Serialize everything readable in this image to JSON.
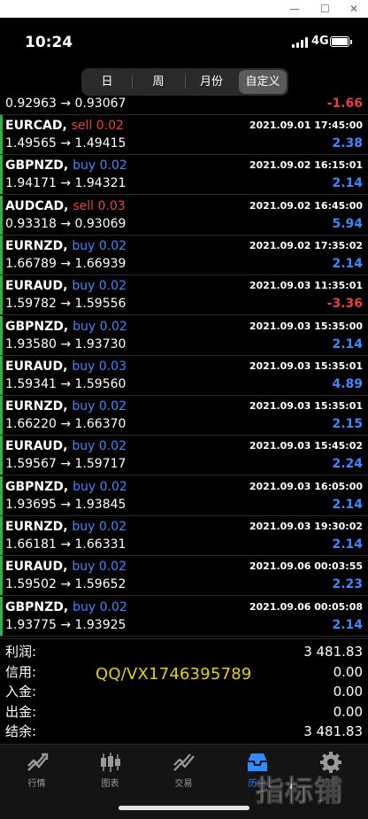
{
  "window": {
    "minimize": "—",
    "maximize": "☐",
    "close": "✕"
  },
  "status": {
    "time": "10:24",
    "network": "4G"
  },
  "tabs": [
    {
      "label": "日"
    },
    {
      "label": "周"
    },
    {
      "label": "月份"
    },
    {
      "label": "自定义",
      "active": true
    }
  ],
  "partial_row": {
    "price": "0.92963 → 0.93067",
    "profit": "-1.66"
  },
  "trades": [
    {
      "symbol": "EURCAD,",
      "side": "sell 0.02",
      "side_type": "sell",
      "date": "2021.09.01 17:45:00",
      "price": "1.49565 → 1.49415",
      "profit": "2.38"
    },
    {
      "symbol": "GBPNZD,",
      "side": "buy 0.02",
      "side_type": "buy",
      "date": "2021.09.02 16:15:01",
      "price": "1.94171 → 1.94321",
      "profit": "2.14"
    },
    {
      "symbol": "AUDCAD,",
      "side": "sell 0.03",
      "side_type": "sell",
      "date": "2021.09.02 16:45:00",
      "price": "0.93318 → 0.93069",
      "profit": "5.94"
    },
    {
      "symbol": "EURNZD,",
      "side": "buy 0.02",
      "side_type": "buy",
      "date": "2021.09.02 17:35:02",
      "price": "1.66789 → 1.66939",
      "profit": "2.14"
    },
    {
      "symbol": "EURAUD,",
      "side": "buy 0.02",
      "side_type": "buy",
      "date": "2021.09.03 11:35:01",
      "price": "1.59782 → 1.59556",
      "profit": "-3.36"
    },
    {
      "symbol": "GBPNZD,",
      "side": "buy 0.02",
      "side_type": "buy",
      "date": "2021.09.03 15:35:00",
      "price": "1.93580 → 1.93730",
      "profit": "2.14"
    },
    {
      "symbol": "EURAUD,",
      "side": "buy 0.03",
      "side_type": "buy",
      "date": "2021.09.03 15:35:01",
      "price": "1.59341 → 1.59560",
      "profit": "4.89"
    },
    {
      "symbol": "EURNZD,",
      "side": "buy 0.02",
      "side_type": "buy",
      "date": "2021.09.03 15:35:01",
      "price": "1.66220 → 1.66370",
      "profit": "2.15"
    },
    {
      "symbol": "EURAUD,",
      "side": "buy 0.02",
      "side_type": "buy",
      "date": "2021.09.03 15:45:02",
      "price": "1.59567 → 1.59717",
      "profit": "2.24"
    },
    {
      "symbol": "GBPNZD,",
      "side": "buy 0.02",
      "side_type": "buy",
      "date": "2021.09.03 16:05:00",
      "price": "1.93695 → 1.93845",
      "profit": "2.14"
    },
    {
      "symbol": "EURNZD,",
      "side": "buy 0.02",
      "side_type": "buy",
      "date": "2021.09.03 19:30:02",
      "price": "1.66181 → 1.66331",
      "profit": "2.14"
    },
    {
      "symbol": "EURAUD,",
      "side": "buy 0.02",
      "side_type": "buy",
      "date": "2021.09.06 00:03:55",
      "price": "1.59502 → 1.59652",
      "profit": "2.23"
    },
    {
      "symbol": "GBPNZD,",
      "side": "buy 0.02",
      "side_type": "buy",
      "date": "2021.09.06 00:05:08",
      "price": "1.93775 → 1.93925",
      "profit": "2.14"
    }
  ],
  "summary": [
    {
      "label": "利润:",
      "value": "3 481.83"
    },
    {
      "label": "信用:",
      "value": "0.00"
    },
    {
      "label": "入金:",
      "value": "0.00"
    },
    {
      "label": "出金:",
      "value": "0.00"
    },
    {
      "label": "结余:",
      "value": "3 481.83"
    }
  ],
  "overlay_text": "QQ/VX1746395789",
  "nav": [
    {
      "label": "行情",
      "icon": "quotes-icon"
    },
    {
      "label": "图表",
      "icon": "chart-icon"
    },
    {
      "label": "交易",
      "icon": "trade-icon"
    },
    {
      "label": "历史",
      "icon": "history-icon",
      "active": true
    },
    {
      "label": "设置",
      "icon": "settings-icon"
    }
  ],
  "watermark_logo": "指标铺",
  "colors": {
    "buy": "#3f87ff",
    "sell": "#e8413a",
    "profit_positive": "#3f87ff",
    "profit_negative": "#e8413a",
    "row_accent": "#2fb344",
    "active_nav": "#2f8cff"
  }
}
